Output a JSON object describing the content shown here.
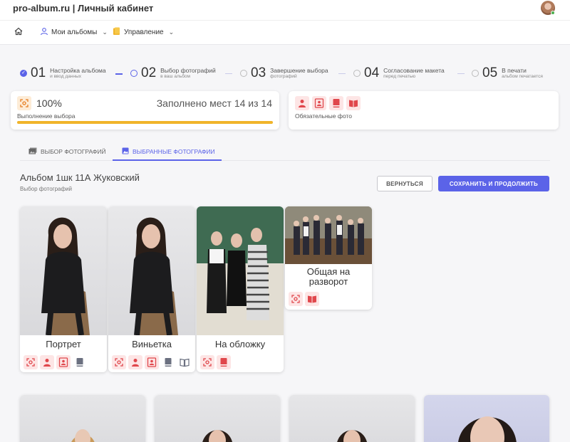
{
  "header": {
    "title": "pro-album.ru | Личный кабинет"
  },
  "nav": {
    "albums_label": "Мои альбомы",
    "manage_label": "Управление"
  },
  "steps": [
    {
      "num": "01",
      "label": "Настройка альбома",
      "sub": "и ввод данных",
      "state": "done"
    },
    {
      "num": "02",
      "label": "Выбор фотографий",
      "sub": "в ваш альбом",
      "state": "active"
    },
    {
      "num": "03",
      "label": "Завершение выбора",
      "sub": "фотографий",
      "state": "pending"
    },
    {
      "num": "04",
      "label": "Согласование макета",
      "sub": "перед печатью",
      "state": "pending"
    },
    {
      "num": "05",
      "label": "В печати",
      "sub": "альбом печатается",
      "state": "pending"
    }
  ],
  "progress": {
    "percent": "100%",
    "fill_fraction": 1.0,
    "places": "Заполнено мест 14 из 14",
    "label": "Выполнение выбора"
  },
  "mandatory": {
    "label": "Обязательные фото"
  },
  "tabs": {
    "select": "ВЫБОР ФОТОГРАФИЙ",
    "selected": "ВЫБРАННЫЕ ФОТОГРАФИИ"
  },
  "album": {
    "title": "Альбом 1шк 11А Жуковский",
    "subtitle": "Выбор фотографий"
  },
  "buttons": {
    "back": "ВЕРНУТЬСЯ",
    "save": "СОХРАНИТЬ И ПРОДОЛЖИТЬ"
  },
  "photos": [
    {
      "name": "Портрет"
    },
    {
      "name": "Виньетка"
    },
    {
      "name": "На обложку"
    },
    {
      "name": "Общая на разворот"
    }
  ],
  "colors": {
    "accent": "#5b63e8",
    "progress": "#f0b42a",
    "icon_red": "#e0474c",
    "icon_grey": "#6b7080"
  }
}
